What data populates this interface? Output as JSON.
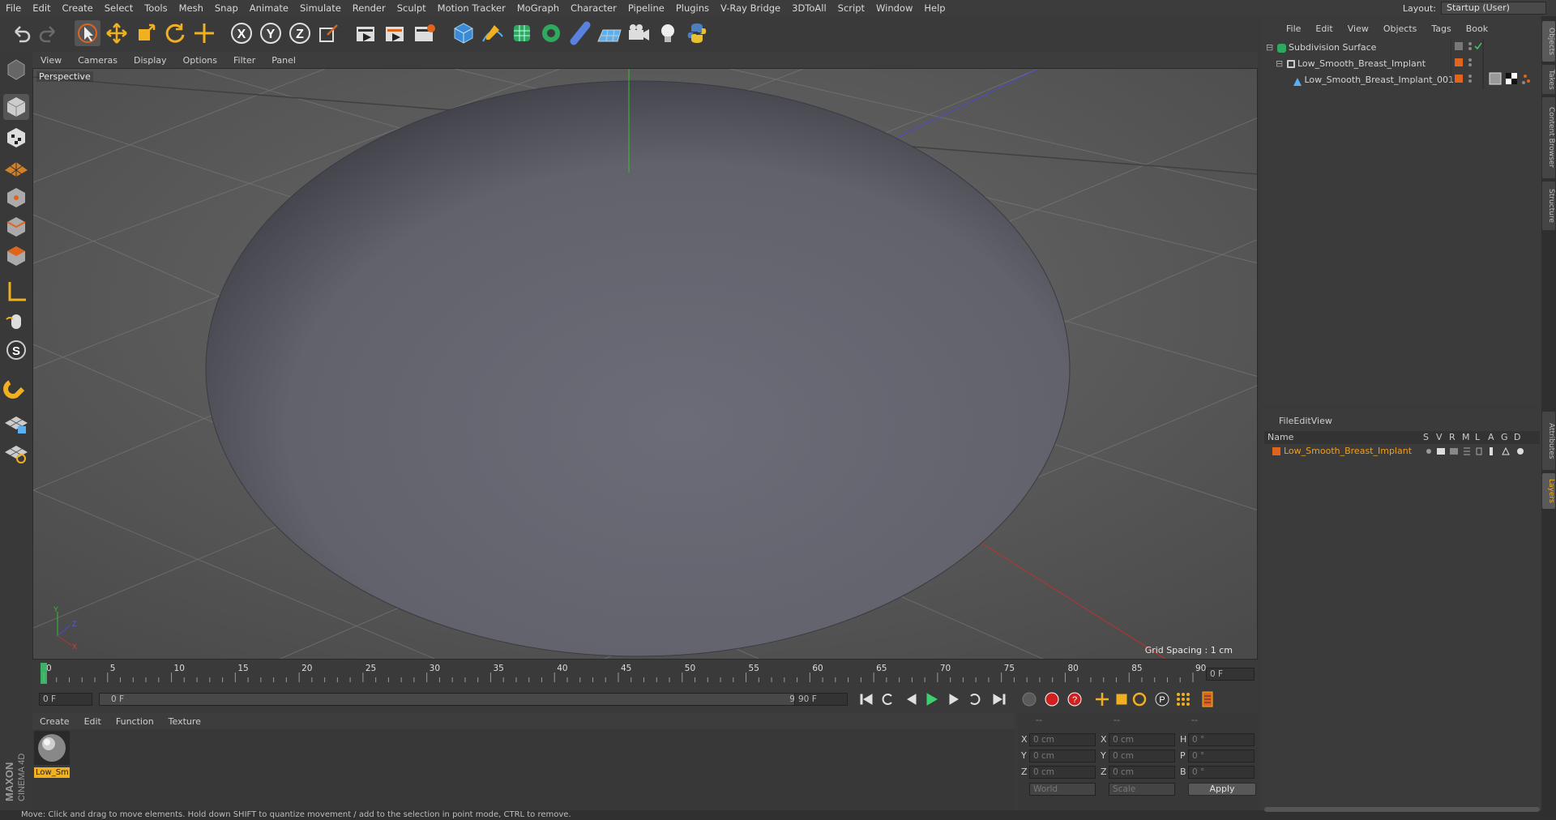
{
  "menu": [
    "File",
    "Edit",
    "Create",
    "Select",
    "Tools",
    "Mesh",
    "Snap",
    "Animate",
    "Simulate",
    "Render",
    "Sculpt",
    "Motion Tracker",
    "MoGraph",
    "Character",
    "Pipeline",
    "Plugins",
    "V-Ray Bridge",
    "3DToAll",
    "Script",
    "Window",
    "Help"
  ],
  "layout": {
    "label": "Layout:",
    "value": "Startup (User)"
  },
  "viewport": {
    "menu": [
      "View",
      "Cameras",
      "Display",
      "Options",
      "Filter",
      "Panel"
    ],
    "label": "Perspective",
    "grid_spacing": "Grid Spacing : 1 cm"
  },
  "timeline": {
    "ticks": [
      "0",
      "5",
      "10",
      "15",
      "20",
      "25",
      "30",
      "35",
      "40",
      "45",
      "50",
      "55",
      "60",
      "65",
      "70",
      "75",
      "80",
      "85",
      "90"
    ],
    "current_frame_field": "0 F",
    "start_field": "0 F",
    "range_start": "0 F",
    "range_end": "90 F",
    "end_field": "90 F"
  },
  "material": {
    "menu": [
      "Create",
      "Edit",
      "Function",
      "Texture"
    ],
    "items": [
      {
        "name": "Low_Sm"
      }
    ]
  },
  "coords": {
    "headers": [
      "--",
      "--",
      "--"
    ],
    "rows": [
      {
        "a": "X",
        "av": "0 cm",
        "b": "X",
        "bv": "0 cm",
        "c": "H",
        "cv": "0 °"
      },
      {
        "a": "Y",
        "av": "0 cm",
        "b": "Y",
        "bv": "0 cm",
        "c": "P",
        "cv": "0 °"
      },
      {
        "a": "Z",
        "av": "0 cm",
        "b": "Z",
        "bv": "0 cm",
        "c": "B",
        "cv": "0 °"
      }
    ],
    "mode": "World",
    "scale": "Scale",
    "apply": "Apply"
  },
  "objects": {
    "menu": [
      "File",
      "Edit",
      "View",
      "Objects",
      "Tags",
      "Book"
    ],
    "tree": [
      {
        "name": "Subdivision Surface"
      },
      {
        "name": "Low_Smooth_Breast_Implant"
      },
      {
        "name": "Low_Smooth_Breast_Implant_001"
      }
    ]
  },
  "layers": {
    "menu": [
      "File",
      "Edit",
      "View"
    ],
    "columns": [
      "Name",
      "S",
      "V",
      "R",
      "M",
      "L",
      "A",
      "G",
      "D"
    ],
    "rows": [
      {
        "name": "Low_Smooth_Breast_Implant",
        "color": "#e0641c"
      }
    ]
  },
  "side_tabs": [
    "Objects",
    "Takes",
    "Content Browser",
    "Structure",
    "Attributes",
    "Layers"
  ],
  "status": "Move: Click and drag to move elements. Hold down SHIFT to quantize movement / add to the selection in point mode, CTRL to remove.",
  "brand": "MAXON CINEMA 4D",
  "colors": {
    "accent": "#e0641c",
    "highlight": "#f0c040",
    "timeline_marker": "#3ed070"
  }
}
